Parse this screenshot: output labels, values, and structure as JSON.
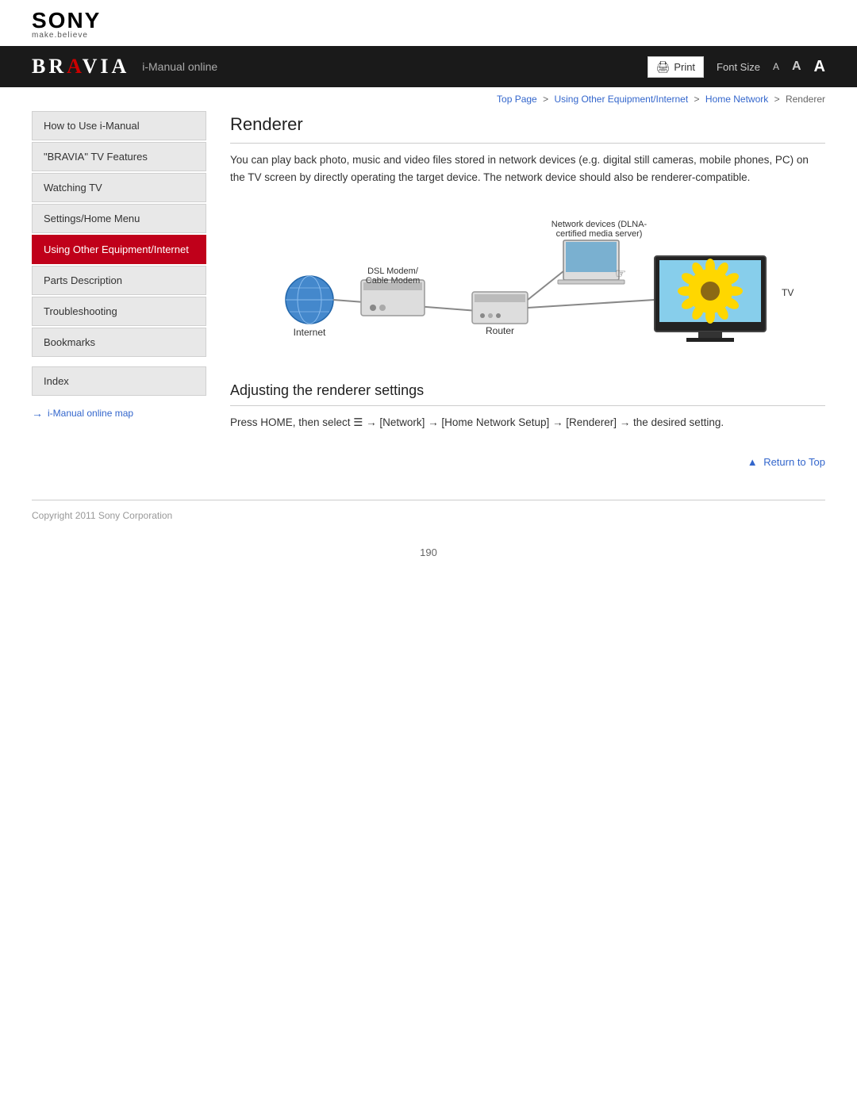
{
  "header": {
    "sony_text": "SONY",
    "tagline": "make.believe",
    "bravia_text": "BRAVIA",
    "subtitle": "i-Manual online",
    "print_label": "Print",
    "font_size_label": "Font Size",
    "font_small": "A",
    "font_medium": "A",
    "font_large": "A"
  },
  "breadcrumb": {
    "top_page": "Top Page",
    "sep1": ">",
    "using_other": "Using Other Equipment/Internet",
    "sep2": ">",
    "home_network": "Home Network",
    "sep3": ">",
    "current": "Renderer"
  },
  "sidebar": {
    "items": [
      {
        "label": "How to Use i-Manual",
        "active": false,
        "id": "how-to-use"
      },
      {
        "label": "\"BRAVIA\" TV Features",
        "active": false,
        "id": "bravia-features"
      },
      {
        "label": "Watching TV",
        "active": false,
        "id": "watching-tv"
      },
      {
        "label": "Settings/Home Menu",
        "active": false,
        "id": "settings-home"
      },
      {
        "label": "Using Other Equipment/Internet",
        "active": true,
        "id": "using-other"
      },
      {
        "label": "Parts Description",
        "active": false,
        "id": "parts-description"
      },
      {
        "label": "Troubleshooting",
        "active": false,
        "id": "troubleshooting"
      },
      {
        "label": "Bookmarks",
        "active": false,
        "id": "bookmarks"
      }
    ],
    "index_label": "Index",
    "imanual_link": "i-Manual online map"
  },
  "content": {
    "page_title": "Renderer",
    "description": "You can play back photo, music and video files stored in network devices (e.g. digital still cameras, mobile phones, PC) on the TV screen by directly operating the target device. The network device should also be renderer-compatible.",
    "diagram": {
      "network_devices_label": "Network devices (DLNA-\ncertified media server)",
      "dsl_modem_label": "DSL Modem/\nCable Modem",
      "internet_label": "Internet",
      "router_label": "Router",
      "tv_label": "TV"
    },
    "section_title": "Adjusting the renderer settings",
    "section_description": "Press HOME, then select ≡ → [Network] → [Home Network Setup] → [Renderer] → the desired setting.",
    "return_to_top": "Return to Top"
  },
  "footer": {
    "copyright": "Copyright 2011 Sony Corporation",
    "page_number": "190"
  }
}
